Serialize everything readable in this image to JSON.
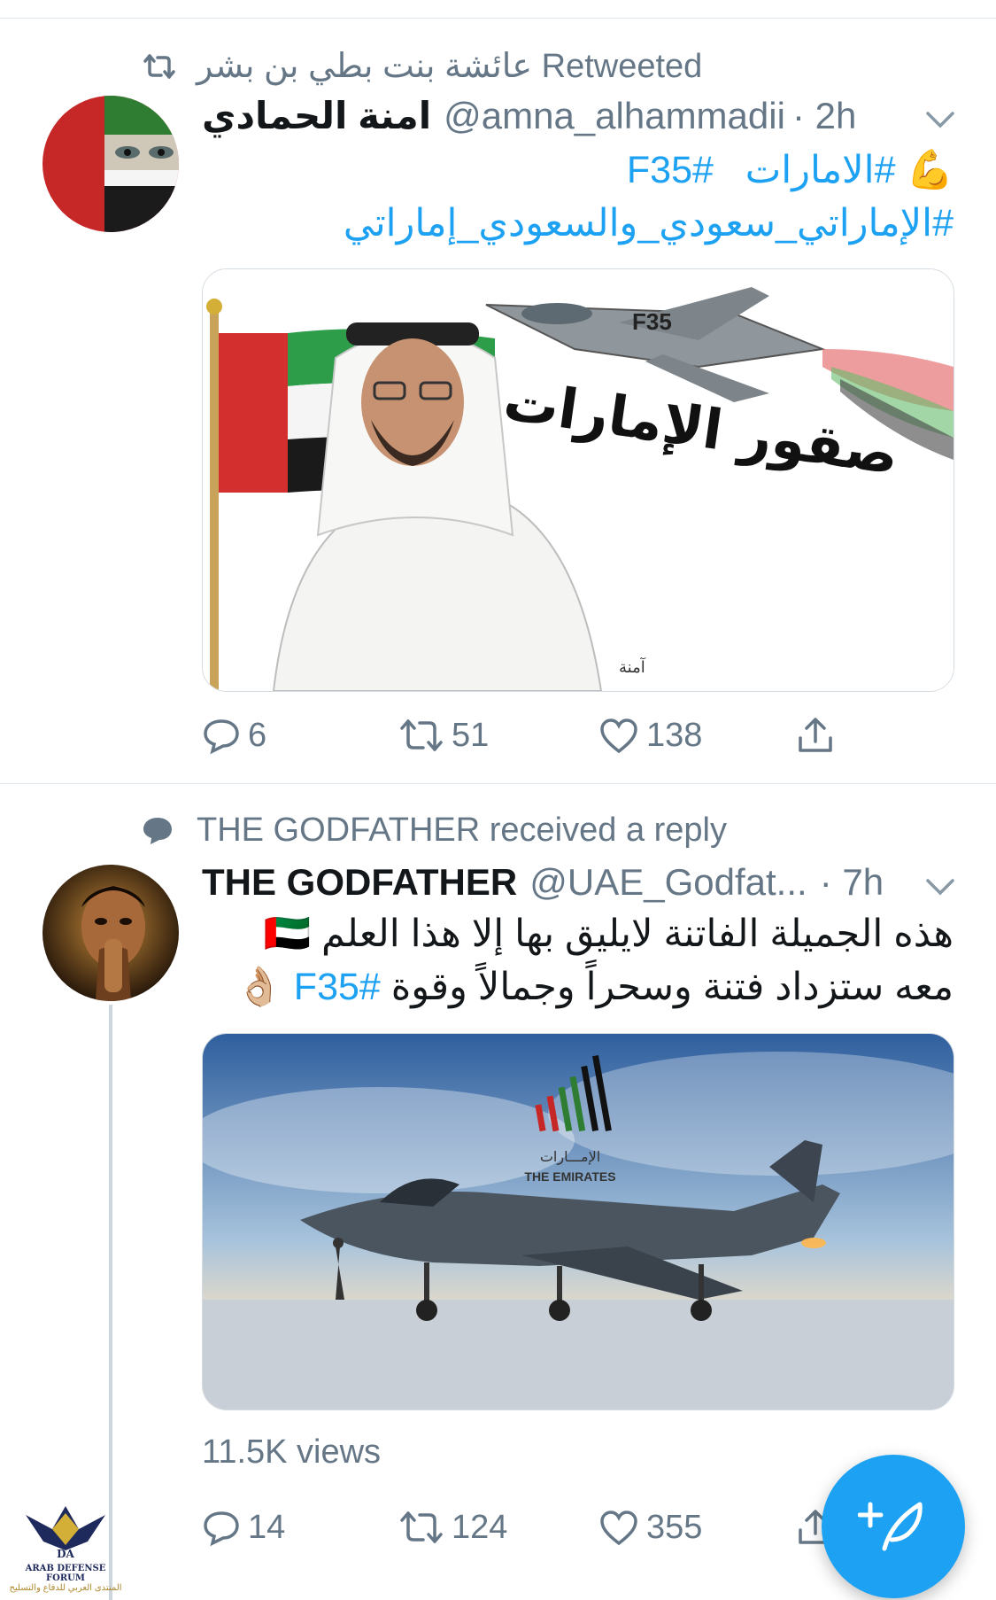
{
  "tweet1": {
    "retweet_text": "عائشة بنت بطي بن بشر Retweeted",
    "name": "امنة الحمادي",
    "handle": "@amna_alhammadii",
    "time": "· 2h",
    "text_line1_emoji": "💪",
    "text_line1_hashtag1": "#الامارات",
    "text_line1_hashtag2": "#F35",
    "text_line2_hashtag": "#الإماراتي_سعودي_والسعودي_إماراتي",
    "image_caption": "صقور الإمارات",
    "image_plane_label": "F35",
    "image_signature": "آمنة",
    "replies": "6",
    "retweets": "51",
    "likes": "138"
  },
  "tweet2": {
    "context_text": "THE GODFATHER received a reply",
    "name": "THE GODFATHER",
    "handle": "@UAE_Godfat...",
    "time": "· 7h",
    "text_line1": "هذه الجميلة الفاتنة لايليق بها إلا هذا العلم",
    "text_line1_flag": "🇦🇪",
    "text_line2": "معه ستزداد فتنة وسحراً وجمالاً وقوة",
    "text_line2_hashtag": "#F35",
    "text_line2_emoji": "👌🏼",
    "image_logo_ar": "الإمـــارات",
    "image_logo_en": "THE EMIRATES",
    "views": "11.5K views",
    "replies": "14",
    "retweets": "124",
    "likes": "355"
  },
  "watermark": {
    "line1": "ARAB DEFENSE FORUM",
    "line2": "المنتدى العربي للدفاع والتسليح",
    "logo_text": "DA"
  },
  "colors": {
    "accent": "#1da1f2",
    "secondary_text": "#657786",
    "divider": "#e1e8ed"
  },
  "icons": [
    "retweet-icon",
    "chevron-down-icon",
    "reply-icon",
    "like-icon",
    "share-icon",
    "comment-bubble-icon",
    "compose-icon"
  ]
}
